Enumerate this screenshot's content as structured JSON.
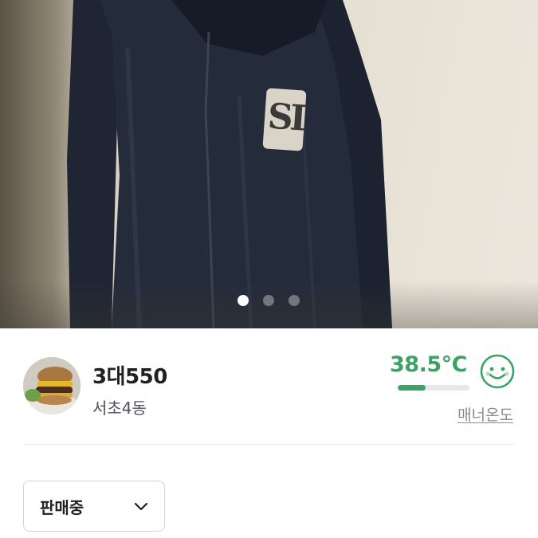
{
  "product": {
    "image_icon": "jacket-photo",
    "image_count": 3,
    "active_image_index": 0,
    "patch_text": "SI"
  },
  "seller": {
    "name": "3대550",
    "location": "서초4동",
    "avatar_icon": "burger-avatar"
  },
  "manner": {
    "temperature": "38.5°C",
    "temperature_fraction": 0.385,
    "face_icon": "smile-face-icon",
    "label": "매너온도",
    "color": "#3aa365"
  },
  "status": {
    "selected": "판매중",
    "icon": "chevron-down-icon"
  }
}
